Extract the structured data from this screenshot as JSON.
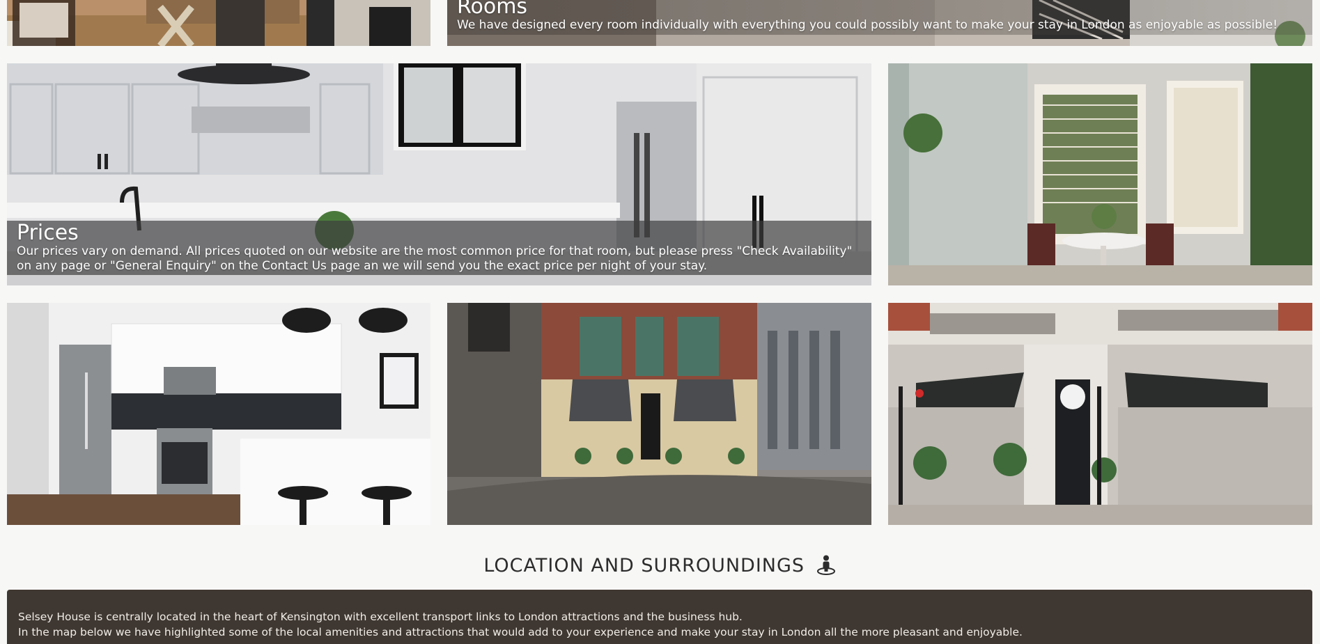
{
  "gallery": {
    "rooms": {
      "title": "Rooms",
      "text": "We have designed every room individually with everything you could possibly want to make your stay in London as enjoyable as possible!"
    },
    "prices": {
      "title": "Prices",
      "text": "Our prices vary on demand. All prices quoted on our website are the most common price for that room, but please press \"Check Availability\" on any page or \"General Enquiry\" on the Contact Us page an we will send you the exact price per night of your stay."
    }
  },
  "location": {
    "heading": "LOCATION AND SURROUNDINGS",
    "icon": "person-pin-icon",
    "paragraphs": [
      "Selsey House is centrally located in the heart of Kensington with excellent transport links to London attractions and the business hub.",
      "In the map below we have highlighted some of the local amenities and attractions that would add to your experience and make your stay in London all the more pleasant and enjoyable."
    ]
  },
  "colors": {
    "page_bg": "#f7f7f6",
    "info_box_bg": "#3f3731",
    "caption_bg": "#3c3c3e"
  }
}
